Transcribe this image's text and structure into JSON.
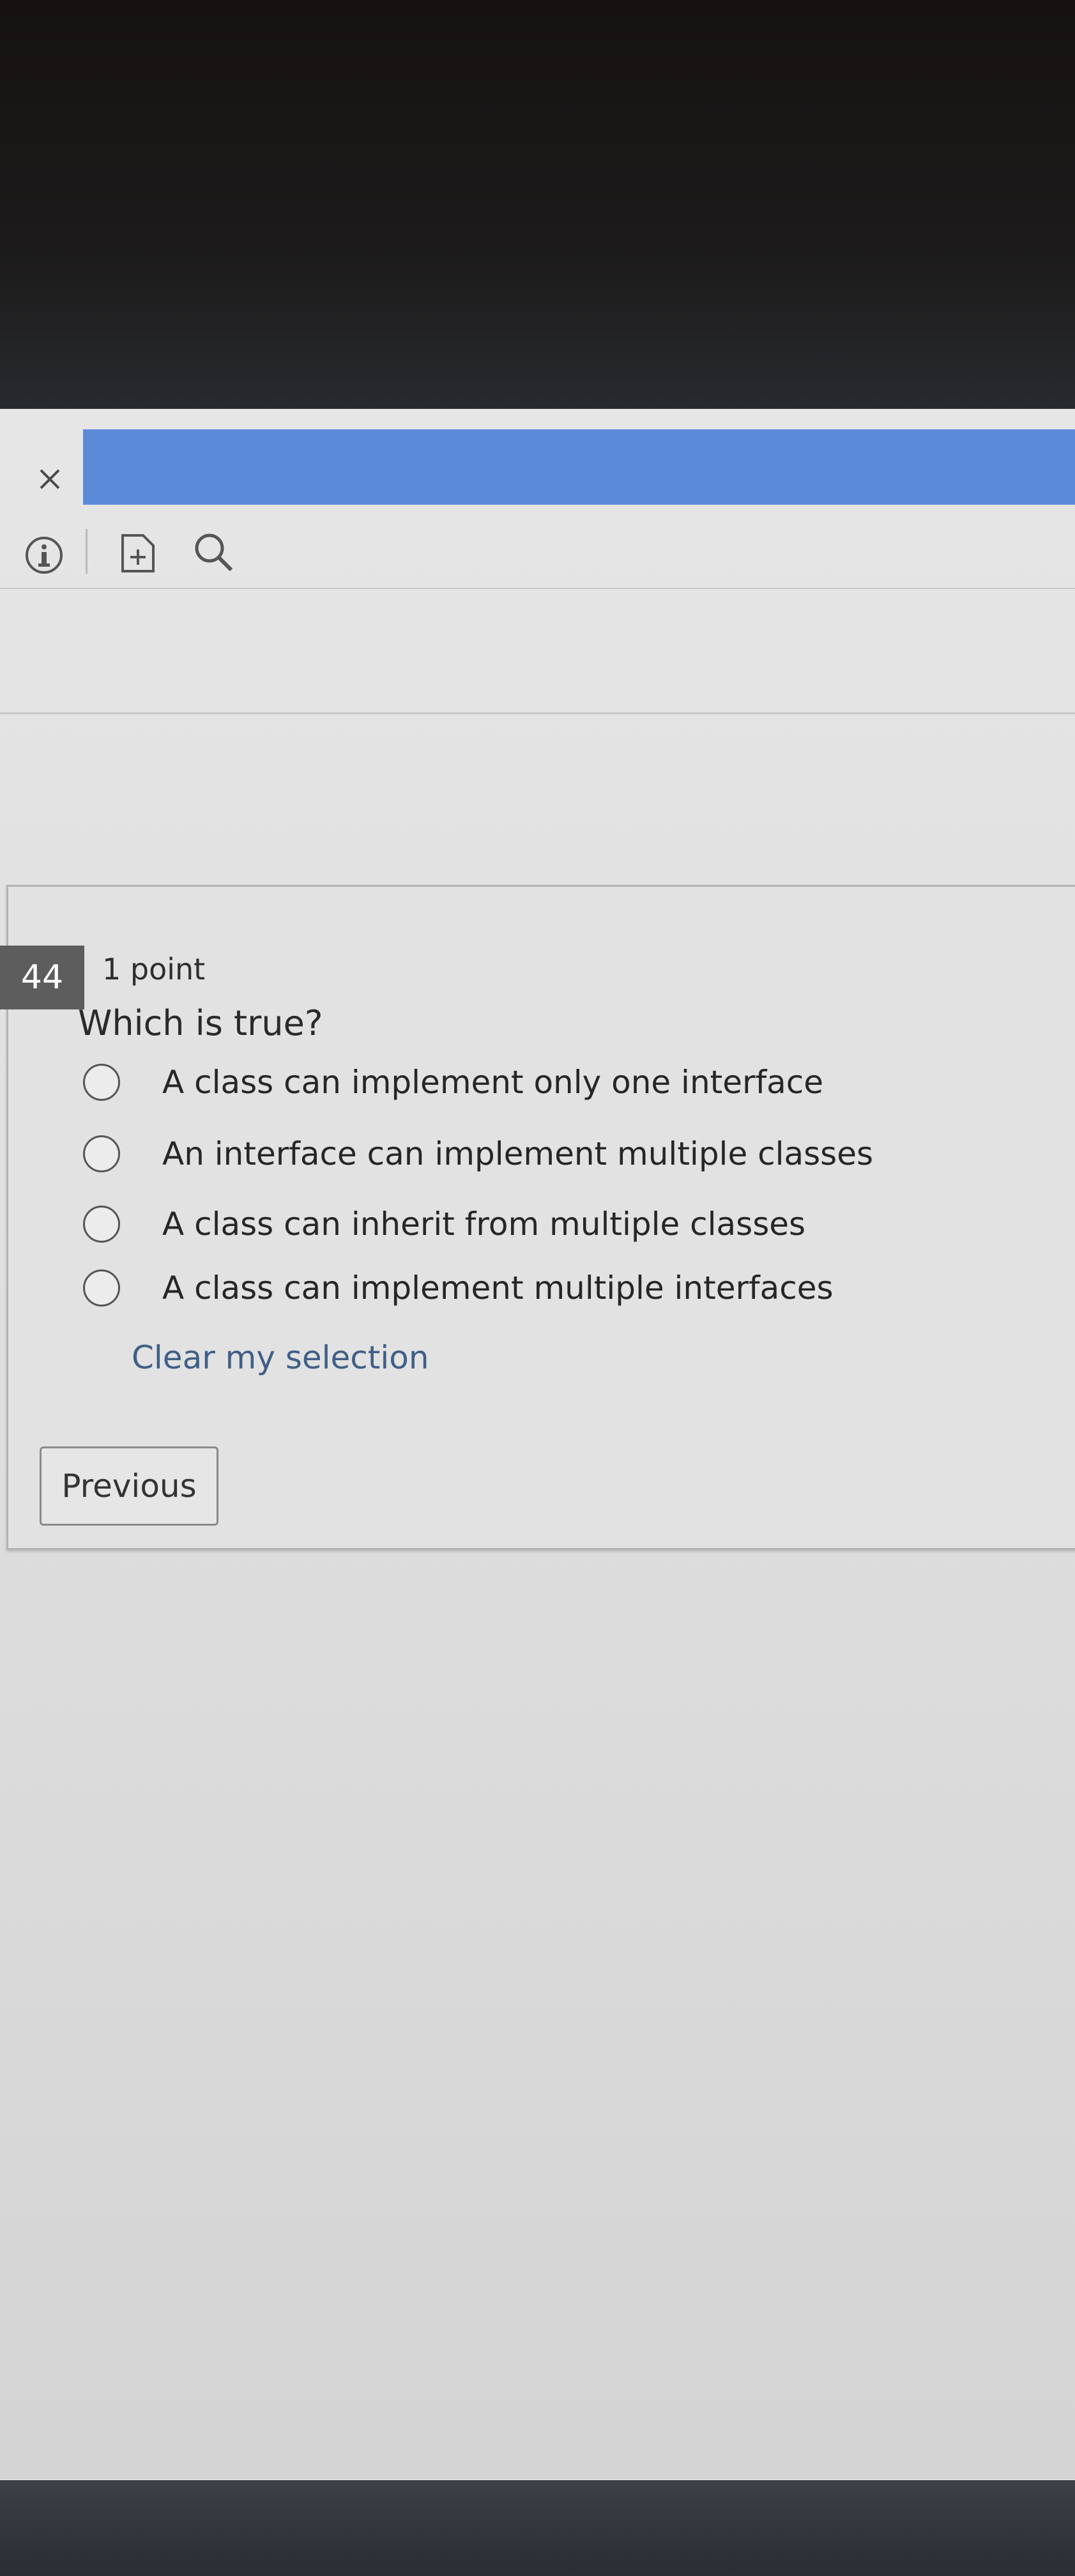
{
  "header": {
    "close_label": "×"
  },
  "toolbar": {
    "icons": [
      "info-icon",
      "note-add-icon",
      "search-icon"
    ]
  },
  "question": {
    "number": "44",
    "points": "1 point",
    "prompt": "Which is true?",
    "options": [
      {
        "label": "A class can implement only one interface",
        "selected": false
      },
      {
        "label": "An interface can implement multiple classes",
        "selected": false
      },
      {
        "label": "A class can inherit from multiple classes",
        "selected": false
      },
      {
        "label": "A class can implement multiple interfaces",
        "selected": false
      }
    ],
    "clear_label": "Clear my selection"
  },
  "navigation": {
    "previous_label": "Previous"
  },
  "colors": {
    "accent_bar": "#5b8ad8",
    "number_badge": "#5d5d5d",
    "link": "#3f5f86"
  }
}
